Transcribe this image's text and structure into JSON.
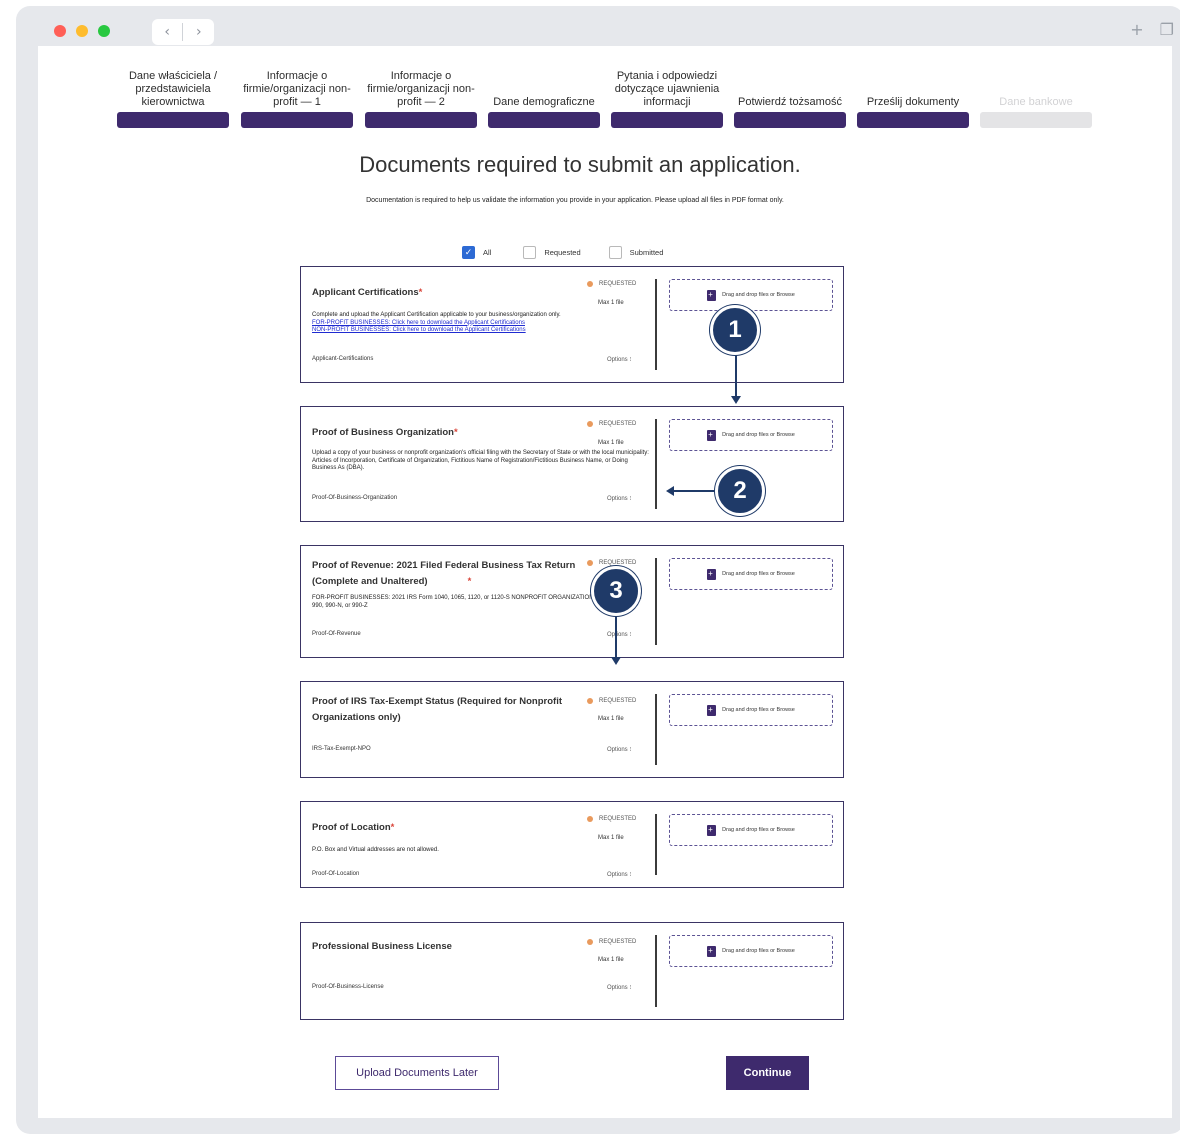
{
  "window": {
    "nav_back": "‹",
    "nav_forward": "›",
    "new_tab_icon": "+",
    "tabs_icon": "❐",
    "dot_colors": [
      "#ff5f57",
      "#febc2e",
      "#28c840"
    ]
  },
  "steps": [
    {
      "label": "Dane właściciela / przedstawiciela kierownictwa",
      "active": true
    },
    {
      "label": "Informacje o firmie/organizacji non-profit — 1",
      "active": true
    },
    {
      "label": "Informacje o firmie/organizacji non-profit — 2",
      "active": true
    },
    {
      "label": "Dane demograficzne",
      "active": true
    },
    {
      "label": "Pytania i odpowiedzi dotyczące ujawnienia informacji",
      "active": true
    },
    {
      "label": "Potwierdź tożsamość",
      "active": true
    },
    {
      "label": "Prześlij dokumenty",
      "active": true
    },
    {
      "label": "Dane bankowe",
      "active": false
    }
  ],
  "title": "Documents required to submit an application.",
  "subtitle": "Documentation is required to help us validate the information you provide in your application. Please upload all files in PDF format only.",
  "filters": [
    {
      "label": "All",
      "checked": true
    },
    {
      "label": "Requested",
      "checked": false
    },
    {
      "label": "Submitted",
      "checked": false
    }
  ],
  "cards": [
    {
      "title": "Applicant Certifications",
      "required": true,
      "status": "REQUESTED",
      "max": "Max 1 file",
      "desc": "Complete and upload the Applicant Certification applicable to your business/organization only.",
      "links": [
        "FOR-PROFIT BUSINESSES: Click here to download the Applicant Certifications",
        "NON-PROFIT BUSINESSES: Click here to download the Applicant Certifications"
      ],
      "tag": "Applicant-Certifications",
      "options": "Options ⁝",
      "drop": "Drag and drop files or Browse"
    },
    {
      "title": "Proof of Business Organization",
      "required": true,
      "status": "REQUESTED",
      "max": "Max 1 file",
      "desc": "Upload a copy of your business or nonprofit organization's official filing with the Secretary of State or with the local municipality: Articles of Incorporation, Certificate of Organization, Fictitious Name of Registration/Fictitious Business Name, or Doing Business As (DBA).",
      "links": [],
      "tag": "Proof-Of-Business-Organization",
      "options": "Options ⁝",
      "drop": "Drag and drop files or Browse"
    },
    {
      "title": "Proof of Revenue: 2021 Filed Federal Business Tax Return (Complete and Unaltered)",
      "required": true,
      "status": "REQUESTED",
      "max": "",
      "desc": "FOR-PROFIT BUSINESSES: 2021 IRS Form 1040, 1065, 1120, or 1120-S NONPROFIT ORGANIZATIONS: 2021 IRS Form 990, 990-N, or 990-Z",
      "links": [],
      "tag": "Proof-Of-Revenue",
      "options": "Options ⁝",
      "drop": "Drag and drop files or Browse"
    },
    {
      "title": "Proof of IRS Tax-Exempt Status (Required for Nonprofit Organizations only)",
      "required": false,
      "status": "REQUESTED",
      "max": "Max 1 file",
      "desc": "",
      "links": [],
      "tag": "IRS-Tax-Exempt-NPO",
      "options": "Options ⁝",
      "drop": "Drag and drop files or Browse"
    },
    {
      "title": "Proof of Location",
      "required": true,
      "status": "REQUESTED",
      "max": "Max 1 file",
      "desc": "P.O. Box and Virtual addresses are not allowed.",
      "links": [],
      "tag": "Proof-Of-Location",
      "options": "Options ⁝",
      "drop": "Drag and drop files or Browse"
    },
    {
      "title": "Professional Business License",
      "required": false,
      "status": "REQUESTED",
      "max": "Max 1 file",
      "desc": "",
      "links": [],
      "tag": "Proof-Of-Business-License",
      "options": "Options ⁝",
      "drop": "Drag and drop files or Browse"
    }
  ],
  "buttons": {
    "later": "Upload Documents Later",
    "continue": "Continue"
  },
  "callouts": [
    "1",
    "2",
    "3"
  ],
  "colors": {
    "brand": "#3e2a6d",
    "callout": "#1f3a68",
    "status_dot": "#e99a5d",
    "required_star": "#d9453a"
  }
}
